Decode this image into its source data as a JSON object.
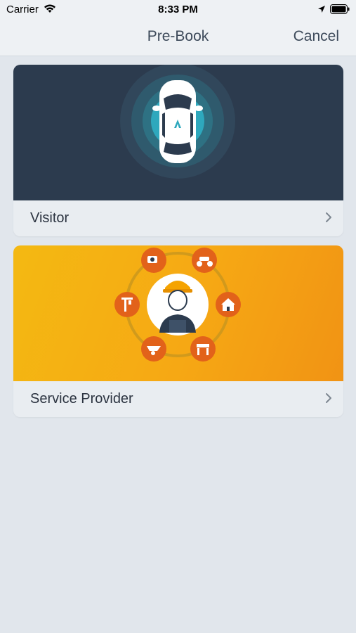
{
  "status_bar": {
    "carrier": "Carrier",
    "time": "8:33 PM"
  },
  "nav": {
    "title": "Pre-Book",
    "cancel_label": "Cancel"
  },
  "options": [
    {
      "label": "Visitor",
      "icon": "car-icon",
      "color": "#2c3b4e"
    },
    {
      "label": "Service Provider",
      "icon": "worker-icon",
      "color": "#f6a814"
    }
  ]
}
